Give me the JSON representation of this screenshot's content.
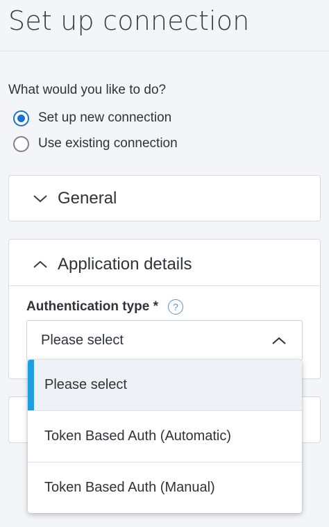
{
  "page": {
    "title": "Set up connection"
  },
  "question": "What would you like to do?",
  "options": [
    {
      "label": "Set up new connection",
      "checked": true
    },
    {
      "label": "Use existing connection",
      "checked": false
    }
  ],
  "sections": {
    "general": {
      "title": "General",
      "state": "collapsed"
    },
    "application_details": {
      "title": "Application details",
      "state": "expanded"
    }
  },
  "auth_field": {
    "label": "Authentication type *",
    "help_icon": "?",
    "value": "Please select",
    "dropdown_open": true
  },
  "dropdown_options": [
    {
      "label": "Please select",
      "selected": true
    },
    {
      "label": "Token Based Auth (Automatic)",
      "selected": false
    },
    {
      "label": "Token Based Auth (Manual)",
      "selected": false
    }
  ],
  "colors": {
    "accent": "#1a73c8",
    "selection_bar": "#1ea0e0",
    "background": "#f3f5f8"
  }
}
